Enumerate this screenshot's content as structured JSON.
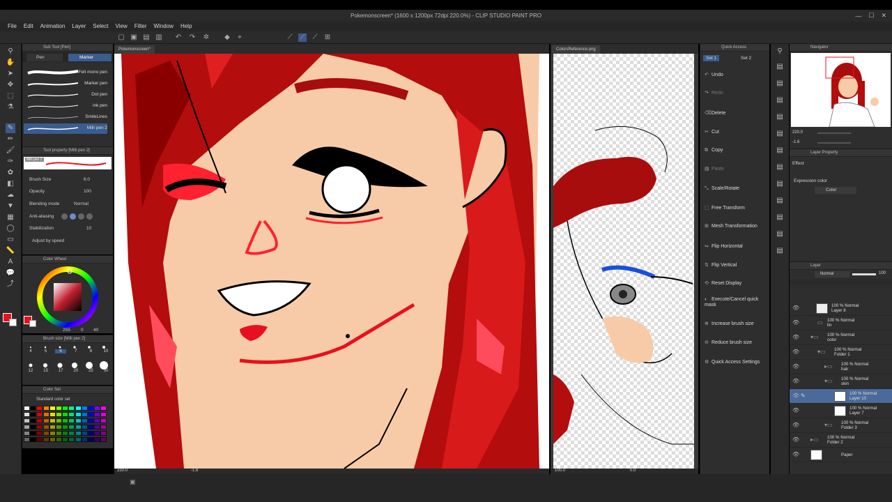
{
  "window": {
    "title": "Pokemonscreen* (1600 x 1200px 72dpi 220.0%) - CLIP STUDIO PAINT PRO",
    "controls": [
      "—",
      "☐",
      "✕"
    ]
  },
  "menu": [
    "File",
    "Edit",
    "Animation",
    "Layer",
    "Select",
    "View",
    "Filter",
    "Window",
    "Help"
  ],
  "subtool": {
    "header": "Sub Tool [Pen]",
    "tabs": [
      "Pen",
      "Marker"
    ],
    "brushes": [
      "Felt mono pen",
      "Marker pen",
      "Dot pen",
      "ink pen",
      "SmileLines",
      "Milli pen 2"
    ]
  },
  "toolprop": {
    "header": "Tool property [Milli pen 2]",
    "preset": "Milli pen 2",
    "brush_size_label": "Brush Size",
    "brush_size": "6.0",
    "opacity_label": "Opacity",
    "opacity": "100",
    "blending_label": "Blending mode",
    "blending": "Normal",
    "aa_label": "Anti-aliasing",
    "stab_label": "Stabilization",
    "stab": "10",
    "adjust_label": "Adjust by speed"
  },
  "colorwheel": {
    "header": "Color Wheel",
    "values": [
      "255",
      "0",
      "40"
    ],
    "main_color": "#e8101e",
    "sub_color": "#ffffff"
  },
  "brushsize": {
    "header": "Brush size [Milli pen 2]",
    "row1": [
      "4",
      "5",
      "6",
      "7",
      "8",
      "10"
    ],
    "row2": [
      "12",
      "15",
      "17",
      "20",
      "25",
      "30"
    ]
  },
  "colorset": {
    "header": "Color Set",
    "set_name": "Standard color set"
  },
  "canvas": {
    "left_tab": "Pokemonscreen*",
    "right_tab": "ColorsReference.png",
    "left_zoom": "220.0",
    "left_angle": "-1.6",
    "right_zoom": "100.0",
    "right_angle": "0.0"
  },
  "quick": {
    "header": "Quick Access",
    "sets": [
      "Set 1",
      "Set 2"
    ],
    "items": [
      "Undo",
      "Redo",
      "Delete",
      "Cut",
      "Copy",
      "Paste",
      "Scale/Rotate",
      "Free Transform",
      "Mesh Transformation",
      "Flip Horizontal",
      "Flip Vertical",
      "Reset Display",
      "Execute/Cancel quick mask",
      "Increase brush size",
      "Reduce brush size",
      "Quick Access Settings"
    ]
  },
  "navigator": {
    "header": "Navigator",
    "zoom": "220.0",
    "angle": "-1.6"
  },
  "layerprop": {
    "header": "Layer Property",
    "effect": "Effect",
    "expression": "Expression color",
    "color": "Color"
  },
  "layers": {
    "header": "Layer",
    "blend": "Normal",
    "opacity": "100",
    "rows": [
      {
        "pct": "100 % Normal",
        "name": "Layer 8"
      },
      {
        "pct": "100 % Normal",
        "name": "lin"
      },
      {
        "pct": "100 % Normal",
        "name": "color"
      },
      {
        "pct": "100 % Normal",
        "name": "Folder 1"
      },
      {
        "pct": "100 % Normal",
        "name": "hair"
      },
      {
        "pct": "100 % Normal",
        "name": "skin"
      },
      {
        "pct": "100 % Normal",
        "name": "Layer 10"
      },
      {
        "pct": "100 % Normal",
        "name": "Layer 7"
      },
      {
        "pct": "100 % Normal",
        "name": "Folder 3"
      },
      {
        "pct": "100 % Normal",
        "name": "Folder 2"
      },
      {
        "pct": "",
        "name": "Paper"
      }
    ]
  }
}
